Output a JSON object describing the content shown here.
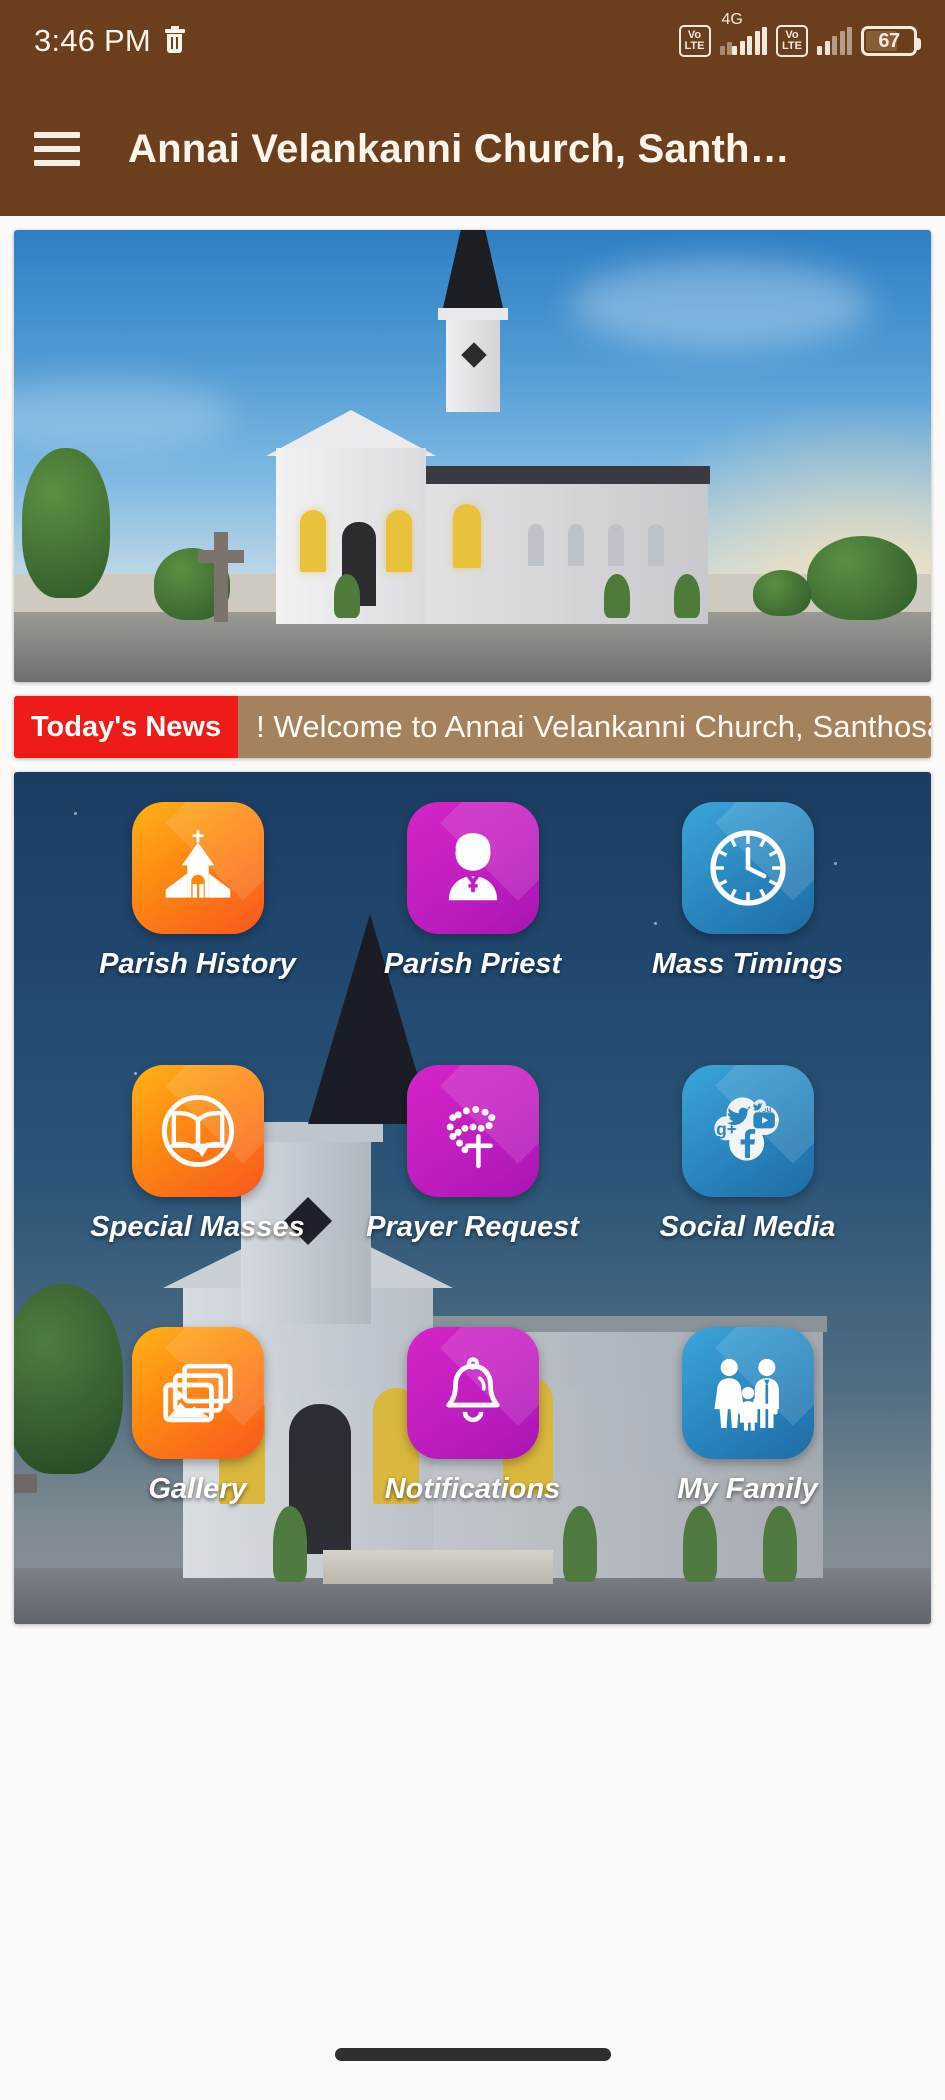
{
  "status_bar": {
    "time": "3:46 PM",
    "trash_icon": "trash-icon",
    "sim1_volte": "VoLTE",
    "network_type": "4G",
    "sim2_volte": "VoLTE",
    "battery_percent": "67"
  },
  "app_bar": {
    "menu_icon": "hamburger-menu-icon",
    "title": "Annai Velankanni Church, Santh…"
  },
  "hero": {
    "alt": "church-exterior-photo"
  },
  "ticker": {
    "badge_label": "Today's News",
    "text": "! Welcome to Annai Velankanni Church, Santhosapuram"
  },
  "colors": {
    "app_bar": "#6b3f1d",
    "ticker_badge": "#ee1b18",
    "ticker_body": "#a5825e",
    "icon_orange": "#fd8a12",
    "icon_magenta": "#c21ec0",
    "icon_blue": "#2b86c0"
  },
  "grid": {
    "items": [
      {
        "label": "Parish History",
        "icon": "church-icon",
        "color": "orange"
      },
      {
        "label": "Parish Priest",
        "icon": "priest-icon",
        "color": "magenta"
      },
      {
        "label": "Mass Timings",
        "icon": "clock-icon",
        "color": "blue"
      },
      {
        "label": "Special Masses",
        "icon": "open-book-icon",
        "color": "orange"
      },
      {
        "label": "Prayer Request",
        "icon": "rosary-icon",
        "color": "magenta"
      },
      {
        "label": "Social Media",
        "icon": "social-media-icon",
        "color": "blue"
      },
      {
        "label": "Gallery",
        "icon": "photo-stack-icon",
        "color": "orange"
      },
      {
        "label": "Notifications",
        "icon": "bell-icon",
        "color": "magenta"
      },
      {
        "label": "My Family",
        "icon": "family-icon",
        "color": "blue"
      }
    ]
  },
  "nav_bar": {
    "gesture_handle": "gesture-navigation-bar"
  }
}
